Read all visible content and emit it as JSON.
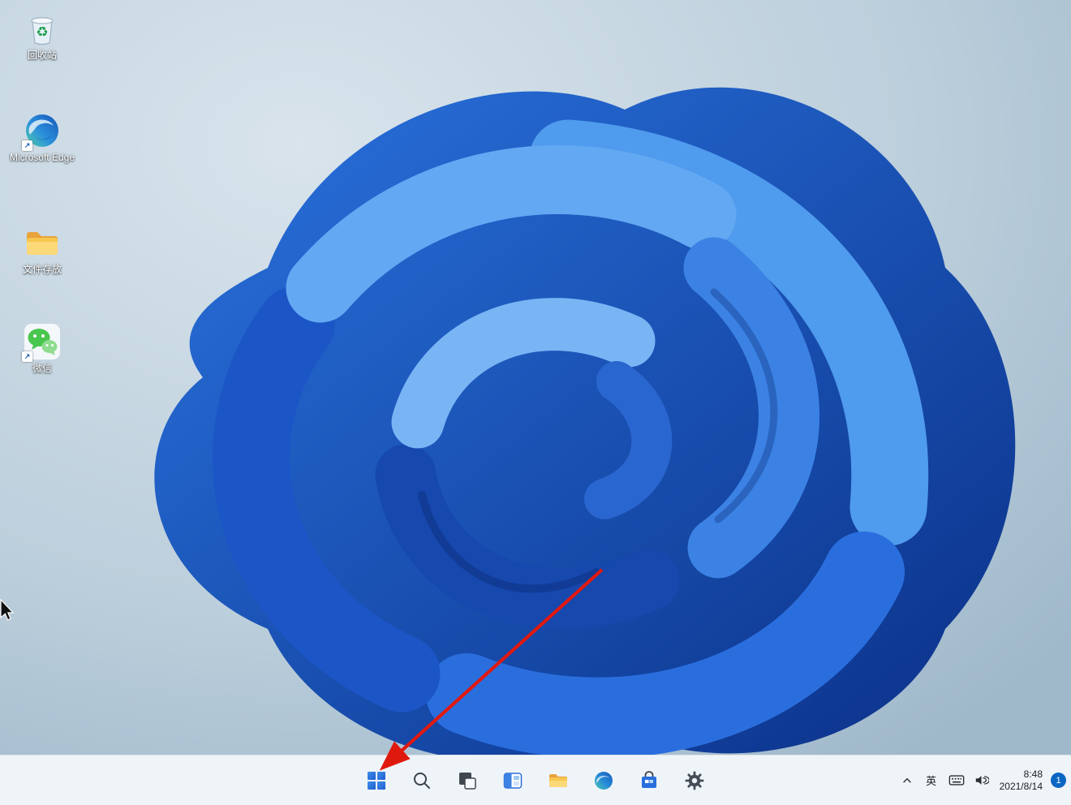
{
  "desktop": {
    "icons": [
      {
        "name": "recycle-bin",
        "label": "回收站"
      },
      {
        "name": "microsoft-edge",
        "label": "Microsoft Edge"
      },
      {
        "name": "folder",
        "label": "文件存放"
      },
      {
        "name": "wechat",
        "label": "微信"
      }
    ]
  },
  "taskbar": {
    "buttons": [
      {
        "name": "start",
        "icon": "windows-logo"
      },
      {
        "name": "search",
        "icon": "magnifier"
      },
      {
        "name": "task-view",
        "icon": "overlapping-squares"
      },
      {
        "name": "widgets",
        "icon": "widgets-panel"
      },
      {
        "name": "file-explorer",
        "icon": "folder"
      },
      {
        "name": "edge",
        "icon": "edge-swirl"
      },
      {
        "name": "store",
        "icon": "shopping-bag"
      },
      {
        "name": "settings",
        "icon": "gear"
      }
    ],
    "tray": {
      "hidden_icons_chevron": "^",
      "ime_label": "英",
      "time": "8:48",
      "date": "2021/8/14",
      "notification_count": "1"
    }
  },
  "annotations": {
    "red_arrow_points_to": "start-button"
  },
  "colors": {
    "taskbar_bg": "#eff4f9",
    "badge_blue": "#0b66c3",
    "arrow_red": "#e0190f",
    "bloom_blue": "#1d5fd0",
    "wallpaper_light": "#d7e2ea"
  }
}
